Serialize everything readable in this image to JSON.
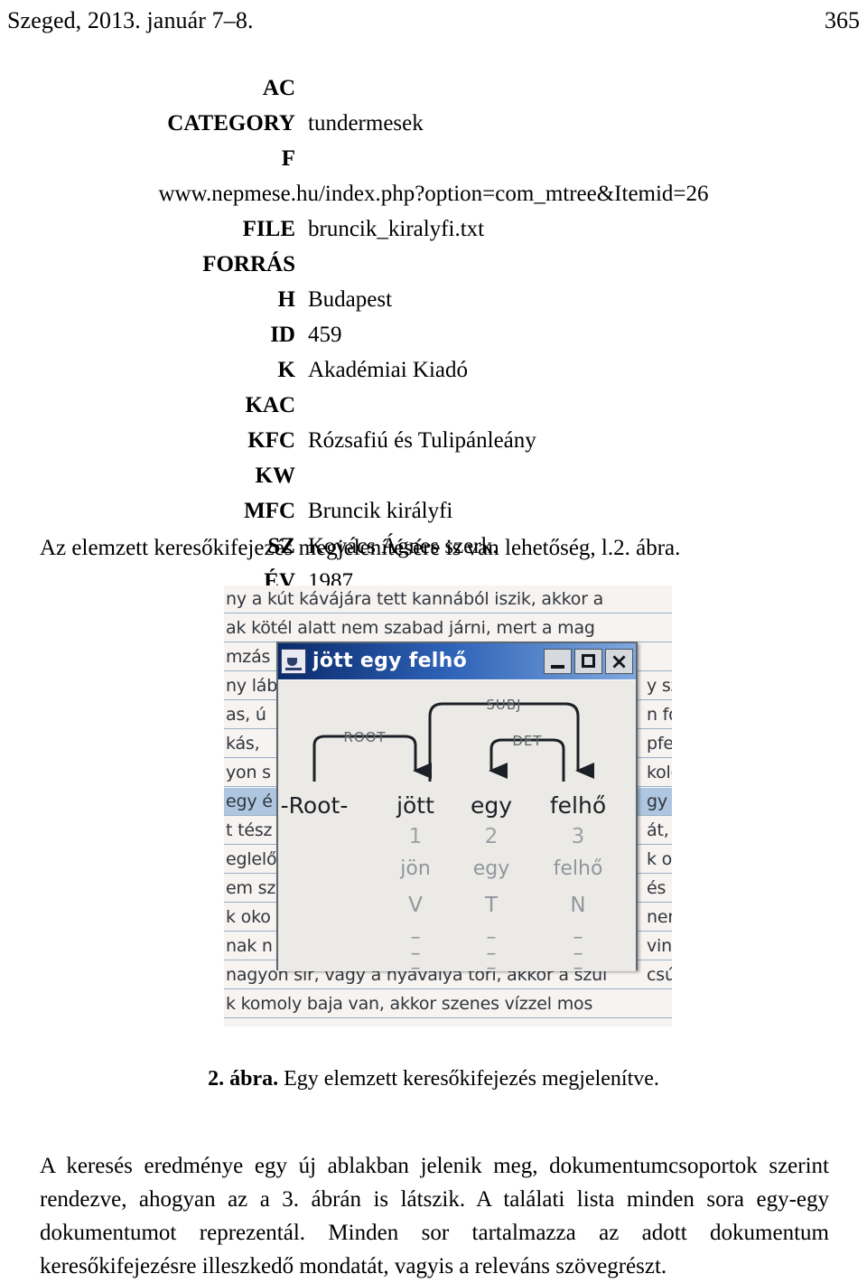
{
  "running_head": {
    "title": "Szeged, 2013. január 7–8.",
    "page_number": "365"
  },
  "metadata_table": {
    "rows": [
      {
        "label": "AC",
        "value": ""
      },
      {
        "label": "CATEGORY",
        "value": "tundermesek"
      },
      {
        "label": "F",
        "value": ""
      },
      {
        "label": "",
        "value": "www.nepmese.hu/index.php?option=com_mtree&Itemid=26",
        "wide": true
      },
      {
        "label": "FILE",
        "value": "bruncik_kiralyfi.txt"
      },
      {
        "label": "FORRÁS",
        "value": ""
      },
      {
        "label": "H",
        "value": "Budapest"
      },
      {
        "label": "ID",
        "value": "459"
      },
      {
        "label": "K",
        "value": "Akadémiai Kiadó"
      },
      {
        "label": "KAC",
        "value": ""
      },
      {
        "label": "KFC",
        "value": "Rózsafiú és Tulipánleány"
      },
      {
        "label": "KW",
        "value": ""
      },
      {
        "label": "MFC",
        "value": "Bruncik királyfi"
      },
      {
        "label": "SZ",
        "value": "Kovács Ágnes szerk."
      },
      {
        "label": "ÉV",
        "value": "1987"
      }
    ]
  },
  "paragraph_reference": "Az elemzett keresőkifejezés megjelenítésére is van lehetőség, l.2. ábra.",
  "figure": {
    "caption_number": "2. ábra.",
    "caption_text": "Egy elemzett keresőkifejezés megjelenítve.",
    "window": {
      "title": "jött egy felhő",
      "icon": "java-coffee-cup-icon",
      "buttons": {
        "minimize": "_",
        "maximize": "□",
        "close": "×"
      }
    },
    "parse": {
      "tokens": [
        {
          "word": "-Root-",
          "index": "",
          "lemma": "",
          "pos": ""
        },
        {
          "word": "jött",
          "index": "1",
          "lemma": "jön",
          "pos": "V"
        },
        {
          "word": "egy",
          "index": "2",
          "lemma": "egy",
          "pos": "T"
        },
        {
          "word": "felhő",
          "index": "3",
          "lemma": "felhő",
          "pos": "N"
        }
      ],
      "arcs": [
        {
          "label": "ROOT",
          "from": "-Root-",
          "to": "jött"
        },
        {
          "label": "SUBJ",
          "from": "jött",
          "to": "felhő"
        },
        {
          "label": "DET",
          "from": "felhő",
          "to": "egy"
        }
      ],
      "empty_marker": "–"
    },
    "background_lines": [
      {
        "text": "ny a kút kávájára tett kannából iszik, akkor a",
        "selected": false
      },
      {
        "text": "ak kötél alatt nem szabad járni, mert a mag",
        "selected": false
      },
      {
        "text": "mzás",
        "selected": false
      },
      {
        "text": "ny láb",
        "selected": false
      },
      {
        "text": "as, ú",
        "selected": false
      },
      {
        "text": "kás,",
        "selected": false
      },
      {
        "text": "yon s",
        "selected": false
      },
      {
        "text": "egy é",
        "selected": true
      },
      {
        "text": "t tész",
        "selected": false
      },
      {
        "text": "eglelő",
        "selected": false
      },
      {
        "text": "em sz",
        "selected": false
      },
      {
        "text": "k oko",
        "selected": false
      },
      {
        "text": "nak n",
        "selected": false
      },
      {
        "text": "nagyon sír, vagy a nyavalya töri, akkor a szül",
        "selected": false
      },
      {
        "text": "k komoly baja van, akkor szenes vízzel mos",
        "selected": false
      }
    ],
    "background_lines_right": [
      "y születi",
      "n fog so",
      "pfelkelte",
      "koldús t",
      "gy ne s",
      "át, mert",
      "k ora alj",
      "és napf",
      "nem tan",
      "vinni a",
      "csúnya a"
    ]
  },
  "paragraph_final": "A keresés eredménye egy új ablakban jelenik meg, dokumentumcsoportok szerint rendezve, ahogyan az a 3. ábrán is látszik. A találati lista minden sora egy-egy dokumentumot reprezentál. Minden sor tartalmazza az adott dokumentum keresőkifejezésre illeszkedő mondatát, vagyis a releváns szövegrészt."
}
